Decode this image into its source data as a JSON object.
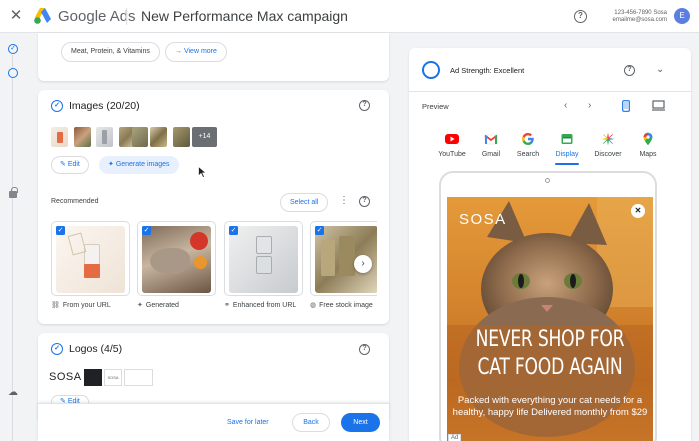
{
  "header": {
    "brand": "Google Ads",
    "campaign_title": "New Performance Max campaign",
    "account_id": "123-456-7890 Sosa",
    "account_email": "emailme@sosa.com",
    "avatar_letter": "E"
  },
  "product_chips": {
    "category": "Meat, Protein, & Vitamins",
    "view_more": "View more"
  },
  "images_section": {
    "title": "Images (20/20)",
    "more_count": "+14",
    "edit_label": "Edit",
    "generate_label": "Generate images",
    "recommended_label": "Recommended",
    "select_all_label": "Select all",
    "recommended": [
      {
        "caption": "From your URL",
        "icon": "link-icon"
      },
      {
        "caption": "Generated",
        "icon": "sparkle-icon"
      },
      {
        "caption": "Enhanced from URL",
        "icon": "enhance-icon"
      },
      {
        "caption": "Free stock image",
        "icon": "globe-icon"
      }
    ]
  },
  "logos_section": {
    "title": "Logos (4/5)",
    "logo_text": "SOSA",
    "logo_text_small": "SOSA",
    "edit_label": "Edit"
  },
  "footer": {
    "save_label": "Save for later",
    "back_label": "Back",
    "next_label": "Next"
  },
  "preview_panel": {
    "strength_label": "Ad Strength: Excellent",
    "preview_label": "Preview",
    "channels": [
      {
        "label": "YouTube",
        "icon": "youtube-icon",
        "active": false
      },
      {
        "label": "Gmail",
        "icon": "gmail-icon",
        "active": false
      },
      {
        "label": "Search",
        "icon": "google-icon",
        "active": false
      },
      {
        "label": "Display",
        "icon": "display-icon",
        "active": true
      },
      {
        "label": "Discover",
        "icon": "discover-icon",
        "active": false
      },
      {
        "label": "Maps",
        "icon": "maps-pin-icon",
        "active": false
      }
    ],
    "ad": {
      "brand": "SOSA",
      "headline_line1": "NEVER SHOP FOR",
      "headline_line2": "CAT FOOD AGAIN",
      "body": "Packed with everything your cat needs for a healthy, happy life Delivered monthly from $29",
      "tag": "Ad"
    }
  },
  "colors": {
    "accent": "#1a73e8",
    "background": "#f1f3f4",
    "ad_orange": "#e8892b"
  }
}
